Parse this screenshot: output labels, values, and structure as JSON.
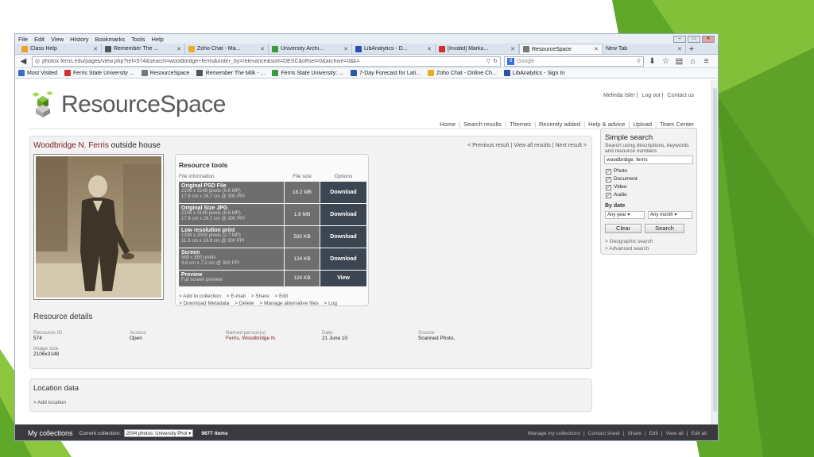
{
  "menubar": {
    "items": [
      "File",
      "Edit",
      "View",
      "History",
      "Bookmarks",
      "Tools",
      "Help"
    ]
  },
  "tabs": [
    {
      "label": "Class Help",
      "color": "#f0a020"
    },
    {
      "label": "Remember The ...",
      "color": "#555555"
    },
    {
      "label": "Zoho Chat - Ma...",
      "color": "#e8b020"
    },
    {
      "label": "University Archi...",
      "color": "#3a9a40"
    },
    {
      "label": "LibAnalytics - D...",
      "color": "#2a4fb0"
    },
    {
      "label": "[Invalid] Marku...",
      "color": "#d03030"
    },
    {
      "label": "ResourceSpace",
      "color": "#777777"
    },
    {
      "label": "New Tab",
      "color": "#ffffff"
    }
  ],
  "navbar": {
    "url": "photox.ferris.edu/pages/view.php?ref=574&search=woodbridge+ferris&order_by=relevance&sort=DESC&offset=0&archive=0&k=",
    "search_placeholder": "Google",
    "search_engine_letter": "8"
  },
  "bookmarks": [
    {
      "label": "Most Visited",
      "color": "#3a6ad0"
    },
    {
      "label": "Ferris State University ...",
      "color": "#d03030"
    },
    {
      "label": "ResourceSpace",
      "color": "#777777"
    },
    {
      "label": "Remember The Milk - ...",
      "color": "#555555"
    },
    {
      "label": "Ferris State University: ...",
      "color": "#3a9a40"
    },
    {
      "label": "7-Day Forecast for Lati...",
      "color": "#2a5aa0"
    },
    {
      "label": "Zoho Chat - Online Ch...",
      "color": "#e8b020"
    },
    {
      "label": "LibAnalytics - Sign In",
      "color": "#2a4fb0"
    }
  ],
  "header": {
    "logo_text": "ResourceSpace",
    "user_links": [
      "Melinda Isler",
      "Log out",
      "Contact us"
    ],
    "nav": [
      "Home",
      "Search results",
      "Themes",
      "Recently added",
      "Help & advice",
      "Upload",
      "Team Center"
    ]
  },
  "resource": {
    "title_part1": "Woodbridge N.",
    "title_part2": "Ferris",
    "title_part3": "outside house",
    "pager": "< Previous result  |  View all results  |  Next result >"
  },
  "tools": {
    "title": "Resource tools",
    "col_info": "File information",
    "col_size": "File size",
    "col_options": "Options",
    "rows": [
      {
        "name": "Original PSD File",
        "desc1": "2106 x 3148 pixels (6.6 MP)",
        "desc2": "17.8 cm x 26.7 cm @ 300 PPI",
        "size": "18.2 MB",
        "action": "Download"
      },
      {
        "name": "Original Size JPG",
        "desc1": "2106 x 3148 pixels (6.6 MP)",
        "desc2": "17.8 cm x 26.7 cm @ 300 PPI",
        "size": "1.6 MB",
        "action": "Download"
      },
      {
        "name": "Low resolution print",
        "desc1": "1338 x 2000 pixels (2.7 MP)",
        "desc2": "11.3 cm x 16.9 cm @ 300 PPI",
        "size": "592 KB",
        "action": "Download"
      },
      {
        "name": "Screen",
        "desc1": "569 x 850 pixels",
        "desc2": "4.8 cm x 7.2 cm @ 300 PPI",
        "size": "124 KB",
        "action": "Download"
      },
      {
        "name": "Preview",
        "desc1": "Full screen preview",
        "desc2": "",
        "size": "124 KB",
        "action": "View"
      }
    ],
    "links_line1": [
      "> Add to collection",
      "> E-mail",
      "> Share",
      "> Edit"
    ],
    "links_line2": [
      "> Download Metadata",
      "> Delete",
      "> Manage alternative files",
      "> Log"
    ]
  },
  "details": {
    "title": "Resource details",
    "fields": [
      {
        "label": "Resource ID",
        "value": "574"
      },
      {
        "label": "Access",
        "value": "Open"
      },
      {
        "label": "Named person(s)",
        "value": "Ferris, Woodbridge N."
      },
      {
        "label": "Date",
        "value": "21 June 10"
      },
      {
        "label": "Source",
        "value": "Scanned Photo,"
      },
      {
        "label": "Image size",
        "value": "2106x3148"
      }
    ]
  },
  "location": {
    "title": "Location data",
    "link": "> Add location"
  },
  "simple_search": {
    "title": "Simple search",
    "subtitle": "Search using descriptions, keywords and resource numbers",
    "query": "woodbridge, ferris",
    "types": [
      "Photo",
      "Document",
      "Video",
      "Audio"
    ],
    "by_date_label": "By date",
    "year": "Any year",
    "month": "Any month",
    "clear_label": "Clear",
    "search_label": "Search",
    "links": [
      "> Geographic search",
      "> Advanced search"
    ]
  },
  "collections": {
    "title": "My collections",
    "current_label": "Current collection:",
    "current_value": "2004 photos: University Phot",
    "count": "9677 items",
    "links": [
      "Manage my collections",
      "Contact sheet",
      "Share",
      "Edit",
      "View all",
      "Edit all"
    ]
  }
}
